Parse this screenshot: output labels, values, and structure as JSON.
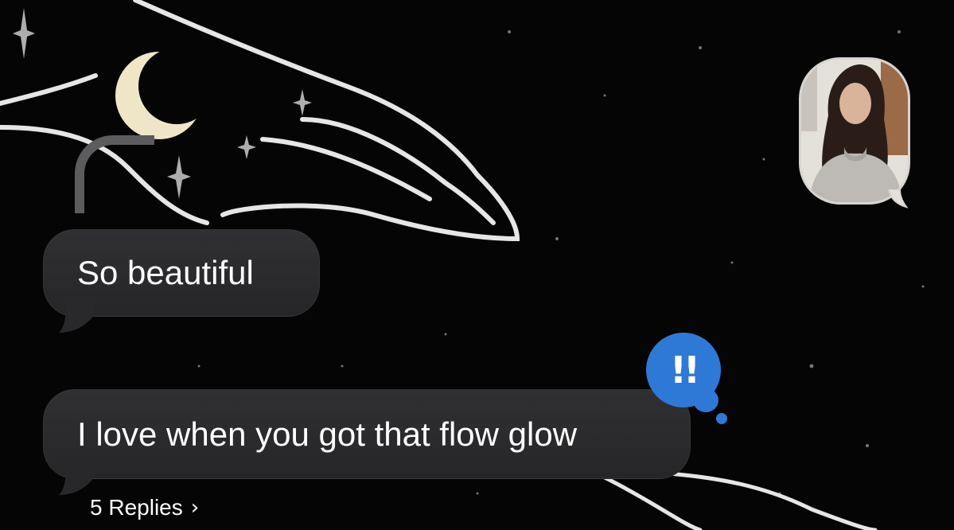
{
  "conversation": {
    "messages": [
      {
        "text": "So beautiful"
      },
      {
        "text": "I love when you got that flow glow",
        "tapback": "!!"
      }
    ],
    "thread": {
      "replies_label": "5 Replies",
      "chevron": "›"
    }
  },
  "contact": {
    "avatar_icon": "person-photo"
  },
  "colors": {
    "bubble": "#2a2a2c",
    "tapback": "#2f79d6",
    "background": "#050505",
    "reply_line": "#5c5c5e"
  }
}
